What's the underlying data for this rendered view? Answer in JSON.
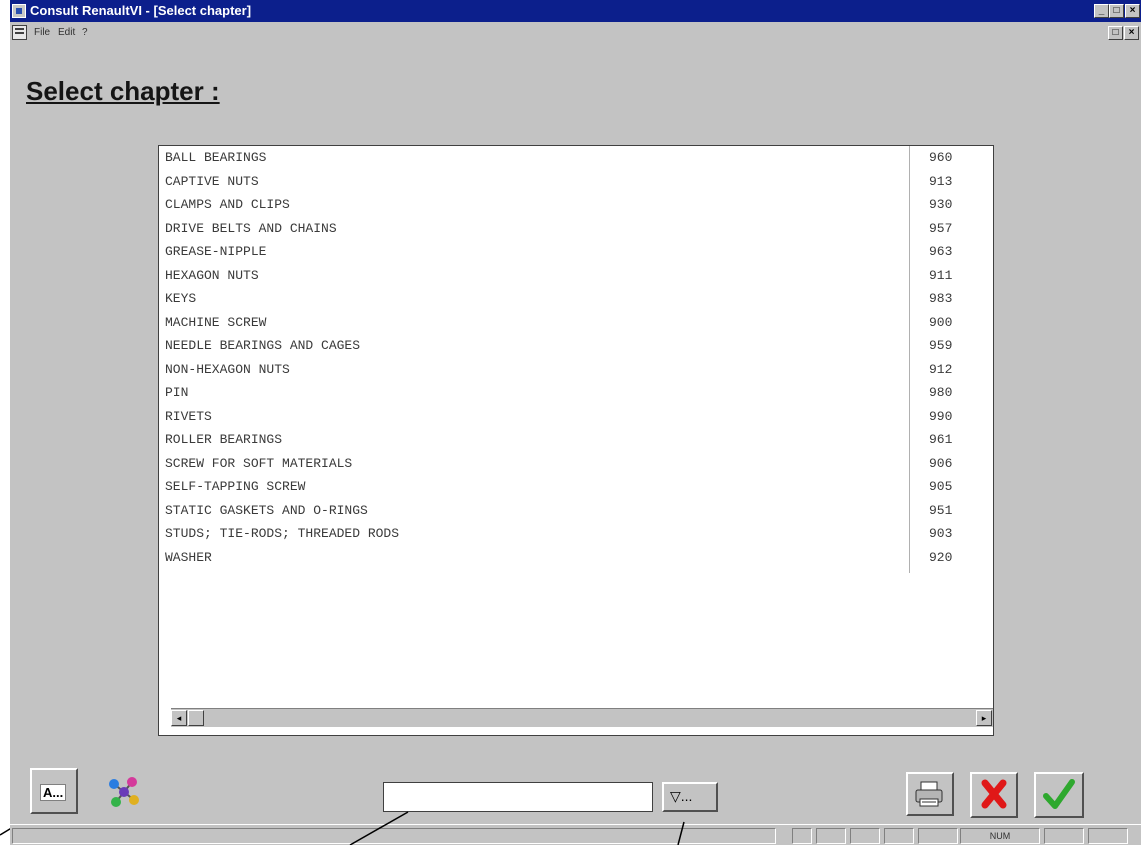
{
  "window": {
    "title": "Consult RenaultVI - [Select chapter]",
    "controls": {
      "minimize": "_",
      "maximize": "□",
      "close": "×"
    }
  },
  "menu": {
    "items": [
      "File",
      "Edit",
      "?"
    ],
    "restore": "□",
    "close": "×"
  },
  "page": {
    "title": "Select chapter :"
  },
  "chapters": [
    {
      "name": "BALL BEARINGS",
      "code": "960"
    },
    {
      "name": "CAPTIVE NUTS",
      "code": "913"
    },
    {
      "name": "CLAMPS AND CLIPS",
      "code": "930"
    },
    {
      "name": "DRIVE BELTS AND CHAINS",
      "code": "957"
    },
    {
      "name": "GREASE-NIPPLE",
      "code": "963"
    },
    {
      "name": "HEXAGON NUTS",
      "code": "911"
    },
    {
      "name": "KEYS",
      "code": "983"
    },
    {
      "name": "MACHINE SCREW",
      "code": "900"
    },
    {
      "name": "NEEDLE BEARINGS AND CAGES",
      "code": "959"
    },
    {
      "name": "NON-HEXAGON NUTS",
      "code": "912"
    },
    {
      "name": "PIN",
      "code": "980"
    },
    {
      "name": "RIVETS",
      "code": "990"
    },
    {
      "name": "ROLLER BEARINGS",
      "code": "961"
    },
    {
      "name": "SCREW FOR SOFT MATERIALS",
      "code": "906"
    },
    {
      "name": "SELF-TAPPING SCREW",
      "code": "905"
    },
    {
      "name": "STATIC GASKETS AND O-RINGS",
      "code": "951"
    },
    {
      "name": "STUDS; TIE-RODS; THREADED RODS",
      "code": "903"
    },
    {
      "name": "WASHER",
      "code": "920"
    }
  ],
  "scrollbar": {
    "left": "◂",
    "right": "▸"
  },
  "toolbar": {
    "alpha_sort_label": "A...",
    "filter_value": "",
    "filter_button_label": "▽..."
  },
  "statusbar": {
    "num_indicator": "NUM"
  },
  "colors": {
    "titlebar": "#0c1f8c",
    "window_bg": "#c3c3c3",
    "cancel_red": "#e01818",
    "ok_green": "#2ea82e"
  },
  "icons": [
    "app-icon",
    "document-icon",
    "molecule-icon",
    "printer-icon",
    "cancel-x-icon",
    "checkmark-icon",
    "filter-icon"
  ]
}
